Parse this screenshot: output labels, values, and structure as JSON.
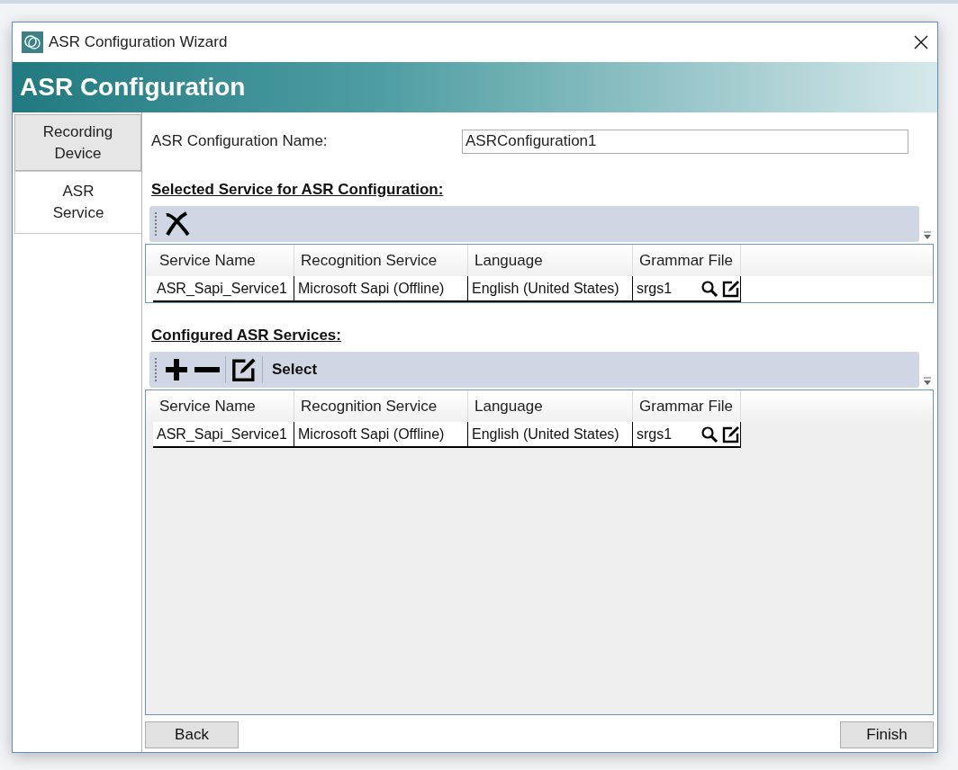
{
  "window": {
    "title": "ASR Configuration Wizard"
  },
  "header": {
    "title": "ASR Configuration"
  },
  "tabs": [
    {
      "label": "Recording Device",
      "selected": false
    },
    {
      "label": "ASR Service",
      "selected": true
    }
  ],
  "config_name": {
    "label": "ASR Configuration Name:",
    "value": "ASRConfiguration1"
  },
  "selected_service": {
    "heading": "Selected Service for ASR Configuration:",
    "columns": [
      "Service Name",
      "Recognition Service",
      "Language",
      "Grammar File"
    ],
    "rows": [
      {
        "cells": [
          "ASR_Sapi_Service1",
          "Microsoft Sapi (Offline)",
          "English (United States)",
          "srgs1"
        ]
      }
    ]
  },
  "configured_services": {
    "heading": "Configured ASR Services:",
    "select_label": "Select",
    "columns": [
      "Service Name",
      "Recognition Service",
      "Language",
      "Grammar File"
    ],
    "rows": [
      {
        "cells": [
          "ASR_Sapi_Service1",
          "Microsoft Sapi (Offline)",
          "English (United States)",
          "srgs1"
        ]
      }
    ]
  },
  "buttons": {
    "back": "Back",
    "finish": "Finish"
  }
}
